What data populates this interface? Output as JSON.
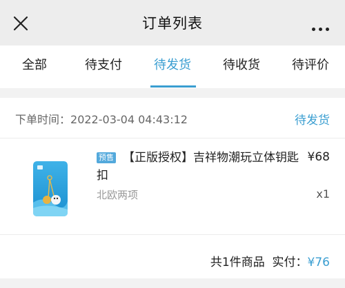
{
  "header": {
    "title": "订单列表",
    "close_icon": "close-icon",
    "more_icon": "more-icon"
  },
  "tabs": [
    {
      "label": "全部",
      "active": false
    },
    {
      "label": "待支付",
      "active": false
    },
    {
      "label": "待发货",
      "active": true
    },
    {
      "label": "待收货",
      "active": false
    },
    {
      "label": "待评价",
      "active": false
    }
  ],
  "order": {
    "time_label": "下单时间：",
    "time_value": "2022-03-04 04:43:12",
    "status": "待发货",
    "item": {
      "tag": "预售",
      "name": "【正版授权】吉祥物潮玩立体钥匙扣",
      "price": "¥68",
      "variant": "北欧两项",
      "quantity": "x1"
    },
    "summary_count": "共1件商品",
    "summary_paid_label": "实付：",
    "summary_paid_value": "¥76"
  },
  "colors": {
    "accent": "#3a9ed1",
    "background": "#f2f2f2",
    "header_bg": "#ededed"
  }
}
